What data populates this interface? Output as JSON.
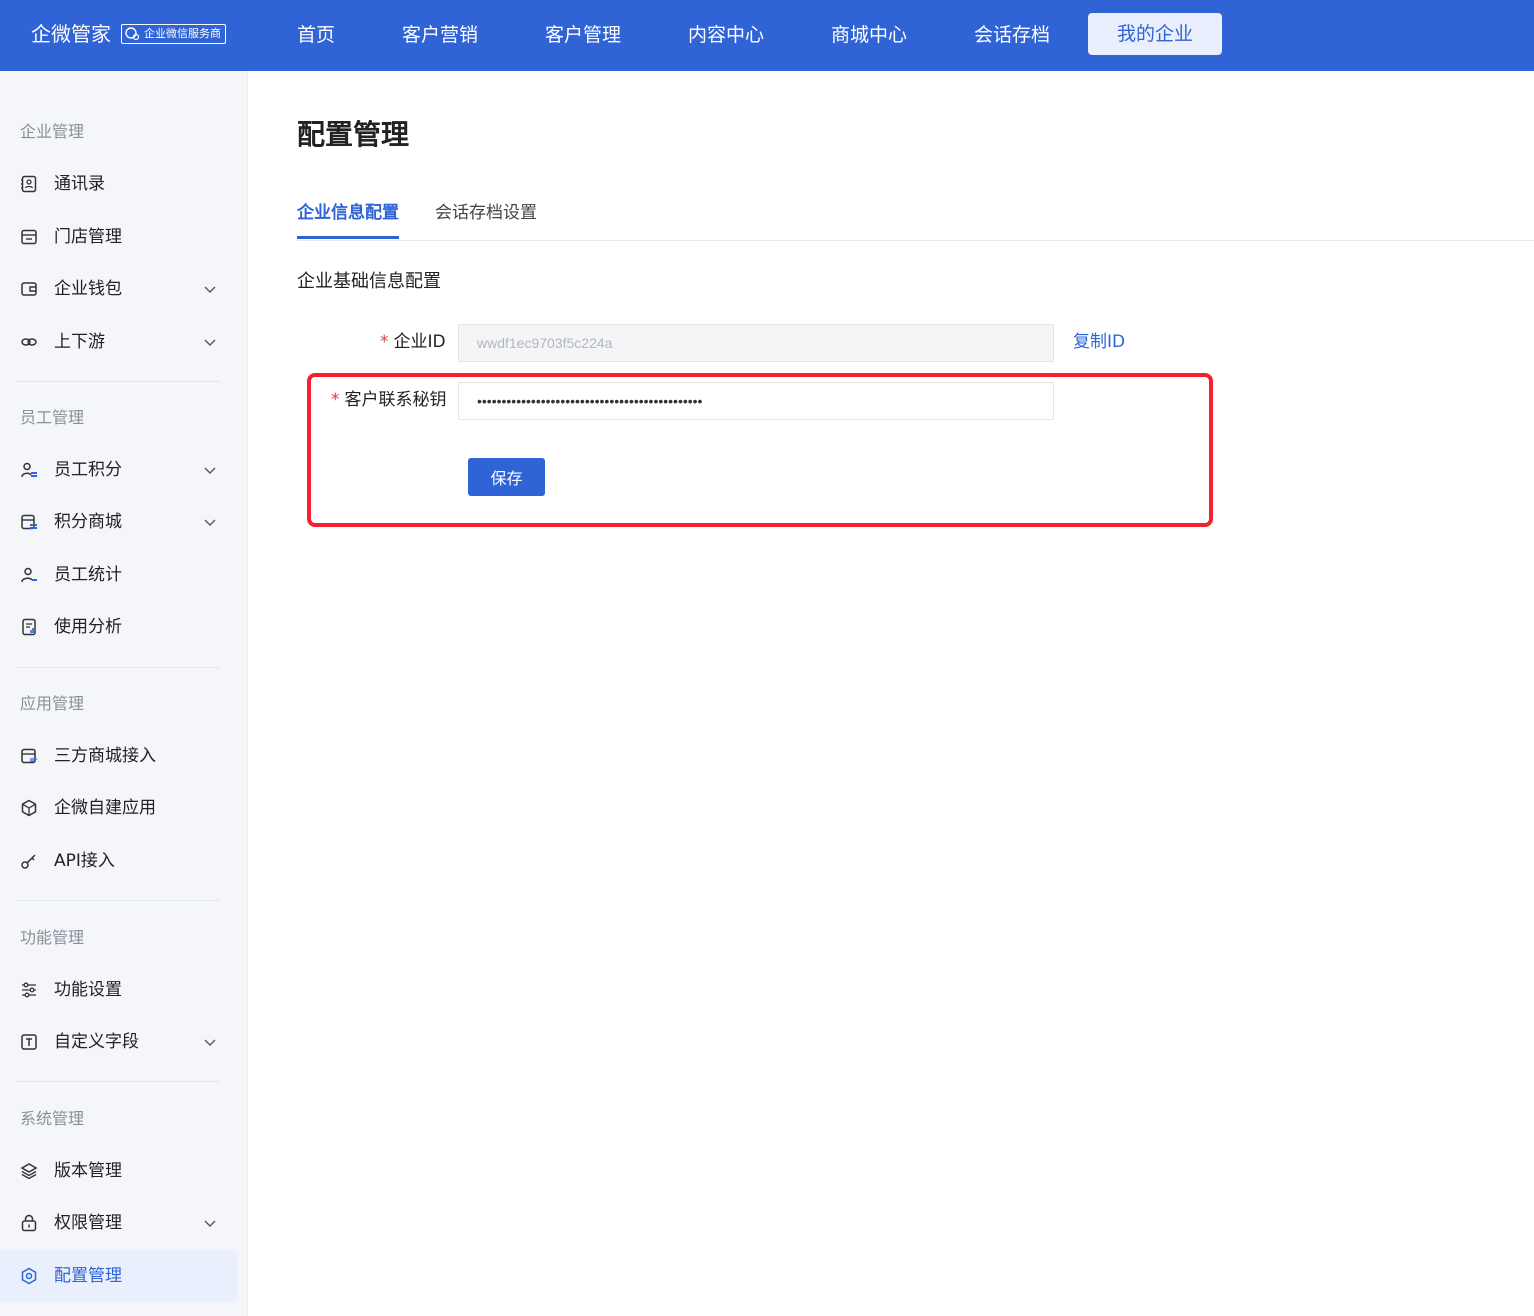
{
  "header": {
    "brand": "企微管家",
    "badge": "企业微信服务商",
    "nav": [
      "首页",
      "客户营销",
      "客户管理",
      "内容中心",
      "商城中心",
      "会话存档",
      "我的企业"
    ],
    "active_nav": "我的企业",
    "color": "#2f63d6"
  },
  "sidebar": {
    "sections": [
      {
        "title": "企业管理",
        "items": [
          {
            "label": "通讯录",
            "icon": "contacts-icon",
            "expandable": false
          },
          {
            "label": "门店管理",
            "icon": "store-icon",
            "expandable": false
          },
          {
            "label": "企业钱包",
            "icon": "wallet-icon",
            "expandable": true
          },
          {
            "label": "上下游",
            "icon": "link-icon",
            "expandable": true
          }
        ]
      },
      {
        "title": "员工管理",
        "items": [
          {
            "label": "员工积分",
            "icon": "user-points-icon",
            "expandable": true
          },
          {
            "label": "积分商城",
            "icon": "points-mall-icon",
            "expandable": true
          },
          {
            "label": "员工统计",
            "icon": "user-stats-icon",
            "expandable": false
          },
          {
            "label": "使用分析",
            "icon": "report-icon",
            "expandable": false
          }
        ]
      },
      {
        "title": "应用管理",
        "items": [
          {
            "label": "三方商城接入",
            "icon": "mall-connect-icon",
            "expandable": false
          },
          {
            "label": "企微自建应用",
            "icon": "cube-icon",
            "expandable": false
          },
          {
            "label": "API接入",
            "icon": "key-icon",
            "expandable": false
          }
        ]
      },
      {
        "title": "功能管理",
        "items": [
          {
            "label": "功能设置",
            "icon": "sliders-icon",
            "expandable": false
          },
          {
            "label": "自定义字段",
            "icon": "text-field-icon",
            "expandable": true
          }
        ]
      },
      {
        "title": "系统管理",
        "items": [
          {
            "label": "版本管理",
            "icon": "layers-icon",
            "expandable": false
          },
          {
            "label": "权限管理",
            "icon": "lock-icon",
            "expandable": true
          },
          {
            "label": "配置管理",
            "icon": "settings-icon",
            "expandable": false,
            "active": true
          }
        ]
      }
    ]
  },
  "main": {
    "title": "配置管理",
    "tabs": [
      {
        "label": "企业信息配置",
        "active": true
      },
      {
        "label": "会话存档设置",
        "active": false
      }
    ],
    "section_title": "企业基础信息配置",
    "form": {
      "corp_id_label": "企业ID",
      "corp_id_value": "wwdf1ec9703f5c224a",
      "copy_label": "复制ID",
      "secret_label": "客户联系秘钥",
      "secret_value": "••••••••••••••••••••••••••••••••••••••••••••••",
      "required_mark": "*",
      "save_label": "保存"
    }
  },
  "colors": {
    "primary": "#2f63d6",
    "highlight": "#f5222d",
    "sidebar_bg": "#f4f6fa"
  }
}
